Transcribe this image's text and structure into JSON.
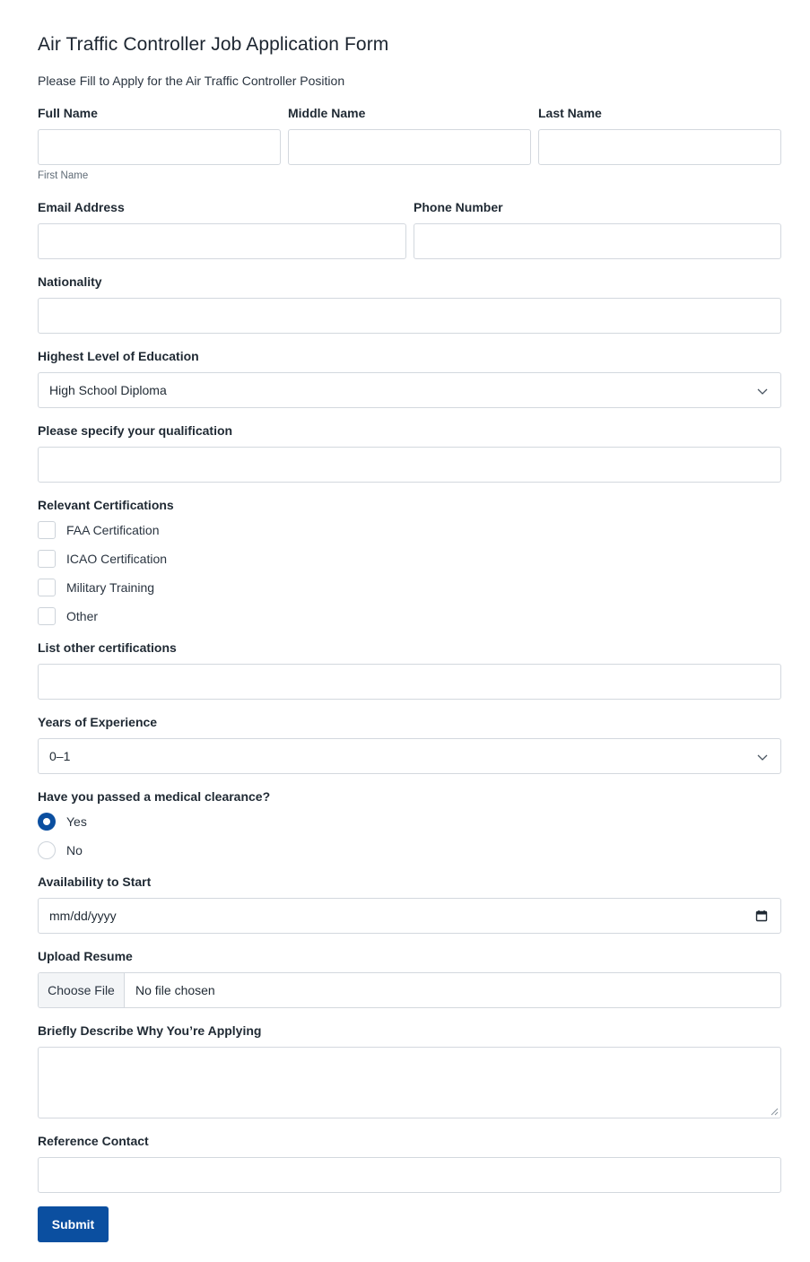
{
  "form": {
    "title": "Air Traffic Controller Job Application Form",
    "subtitle": "Please Fill to Apply for the Air Traffic Controller Position"
  },
  "name": {
    "full_label": "Full Name",
    "middle_label": "Middle Name",
    "last_label": "Last Name",
    "first_sublabel": "First Name"
  },
  "contact": {
    "email_label": "Email Address",
    "phone_label": "Phone Number"
  },
  "nationality": {
    "label": "Nationality"
  },
  "education": {
    "label": "Highest Level of Education",
    "selected": "High School Diploma"
  },
  "qualification": {
    "label": "Please specify your qualification"
  },
  "certifications": {
    "label": "Relevant Certifications",
    "options": [
      "FAA Certification",
      "ICAO Certification",
      "Military Training",
      "Other"
    ]
  },
  "other_certs": {
    "label": "List other certifications"
  },
  "experience": {
    "label": "Years of Experience",
    "selected": "0–1"
  },
  "medical": {
    "label": "Have you passed a medical clearance?",
    "options": [
      "Yes",
      "No"
    ],
    "selected": "Yes"
  },
  "availability": {
    "label": "Availability to Start",
    "placeholder": "mm/dd/yyyy"
  },
  "resume": {
    "label": "Upload Resume",
    "button_label": "Choose File",
    "status": "No file chosen"
  },
  "reason": {
    "label": "Briefly Describe Why You’re Applying"
  },
  "reference": {
    "label": "Reference Contact"
  },
  "submit_label": "Submit",
  "colors": {
    "accent": "#0b4fa0",
    "border": "#d3d8de"
  }
}
